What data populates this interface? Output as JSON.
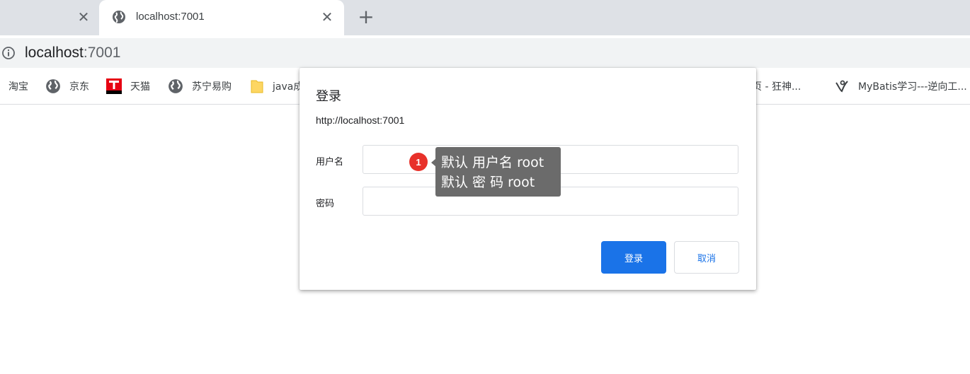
{
  "tabs": [
    {
      "title": "",
      "active": false
    },
    {
      "title": "localhost:7001",
      "active": true
    }
  ],
  "tab_close_glyph": "✕",
  "new_tab_glyph": "+",
  "omnibox": {
    "host": "localhost",
    "port": ":7001"
  },
  "bookmarks": [
    {
      "label": "淘宝",
      "icon": "none"
    },
    {
      "label": "京东",
      "icon": "globe-icon"
    },
    {
      "label": "天猫",
      "icon": "tmall-icon"
    },
    {
      "label": "苏宁易购",
      "icon": "globe-icon"
    },
    {
      "label": "java成",
      "icon": "folder-icon"
    },
    {
      "label": "页 - 狂神...",
      "icon": "none"
    },
    {
      "label": "MyBatis学习---逆向工...",
      "icon": "mybatis-icon"
    }
  ],
  "dialog": {
    "title": "登录",
    "origin": "http://localhost:7001",
    "username_label": "用户名",
    "password_label": "密码",
    "username_value": "",
    "password_value": "",
    "login_button": "登录",
    "cancel_button": "取消"
  },
  "annotation": {
    "badge": "1",
    "line1": "默认 用户名 root",
    "line2": "默认 密 码 root"
  },
  "colors": {
    "accent": "#1a73e8",
    "badge": "#e8312a",
    "tooltip_bg": "#6b6b6b",
    "tabstrip": "#dee1e6",
    "omnibox": "#f1f3f4"
  }
}
